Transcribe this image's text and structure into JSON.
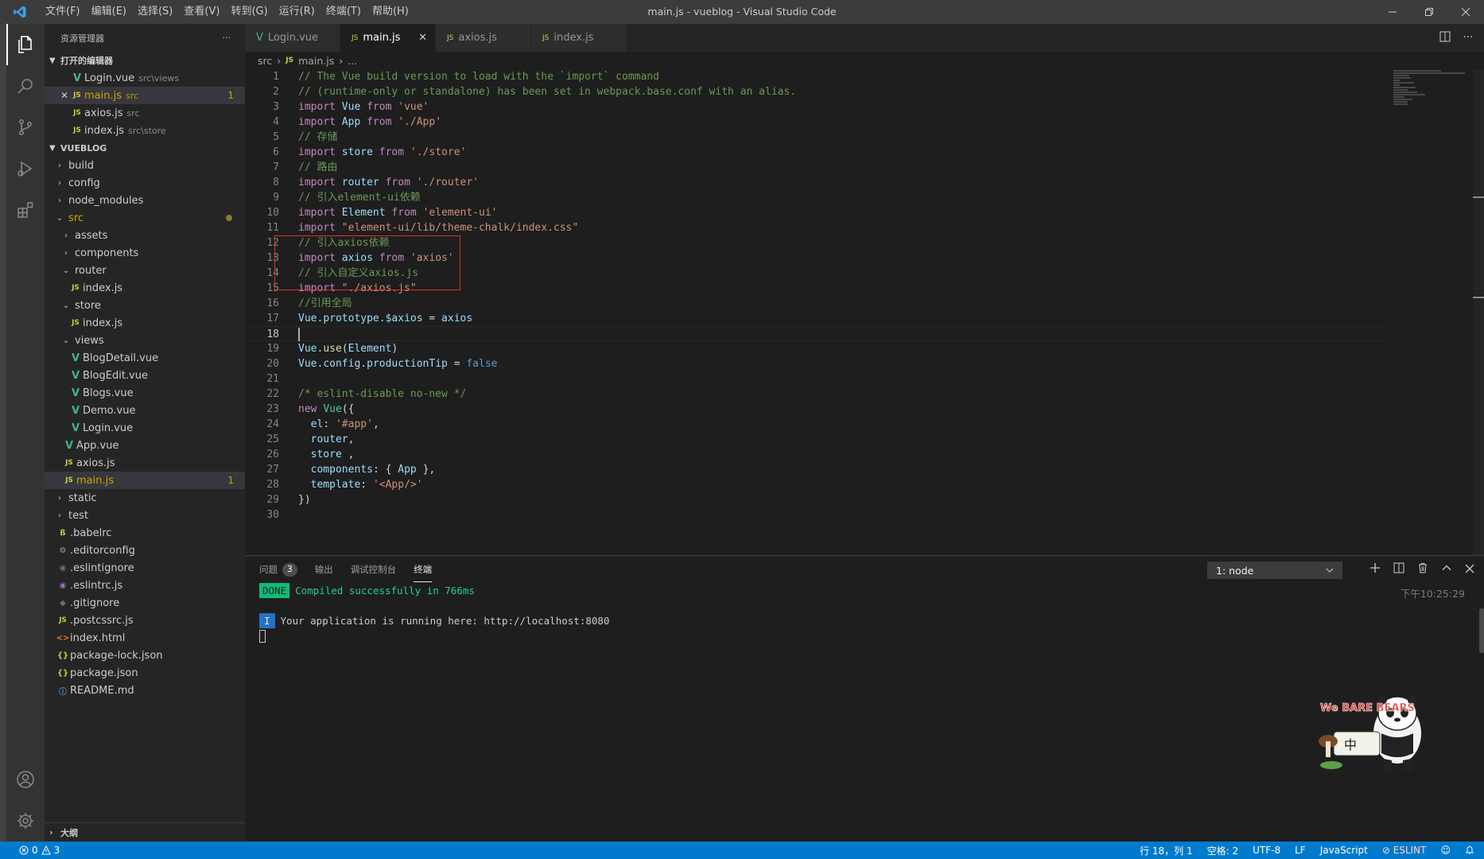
{
  "window": {
    "title": "main.js - vueblog - Visual Studio Code",
    "menu": [
      "文件(F)",
      "编辑(E)",
      "选择(S)",
      "查看(V)",
      "转到(G)",
      "运行(R)",
      "终端(T)",
      "帮助(H)"
    ]
  },
  "sidebar": {
    "header": "资源管理器",
    "more": "···",
    "open_editors": {
      "title": "打开的编辑器",
      "items": [
        {
          "icon": "V",
          "name": "Login.vue",
          "desc": "src\\views"
        },
        {
          "icon": "JS",
          "name": "main.js",
          "desc": "src",
          "badge": "1",
          "close": "✕"
        },
        {
          "icon": "JS",
          "name": "axios.js",
          "desc": "src"
        },
        {
          "icon": "JS",
          "name": "index.js",
          "desc": "src\\store"
        }
      ]
    },
    "project": {
      "title": "VUEBLOG",
      "tree": [
        {
          "name": "build"
        },
        {
          "name": "config"
        },
        {
          "name": "node_modules"
        },
        {
          "name": "src"
        },
        {
          "name": "assets"
        },
        {
          "name": "components"
        },
        {
          "name": "router"
        },
        {
          "name": "index.js"
        },
        {
          "name": "store"
        },
        {
          "name": "index.js"
        },
        {
          "name": "views"
        },
        {
          "name": "BlogDetail.vue"
        },
        {
          "name": "BlogEdit.vue"
        },
        {
          "name": "Blogs.vue"
        },
        {
          "name": "Demo.vue"
        },
        {
          "name": "Login.vue"
        },
        {
          "name": "App.vue"
        },
        {
          "name": "axios.js"
        },
        {
          "name": "main.js",
          "badge": "1"
        },
        {
          "name": "static"
        },
        {
          "name": "test"
        },
        {
          "name": ".babelrc"
        },
        {
          "name": ".editorconfig"
        },
        {
          "name": ".eslintignore"
        },
        {
          "name": ".eslintrc.js"
        },
        {
          "name": ".gitignore"
        },
        {
          "name": ".postcssrc.js"
        },
        {
          "name": "index.html"
        },
        {
          "name": "package-lock.json"
        },
        {
          "name": "package.json"
        },
        {
          "name": "README.md"
        }
      ]
    },
    "outline_title": "大纲"
  },
  "editor": {
    "tabs": [
      {
        "icon": "V",
        "label": "Login.vue"
      },
      {
        "icon": "JS",
        "label": "main.js",
        "close": "✕"
      },
      {
        "icon": "JS",
        "label": "axios.js"
      },
      {
        "icon": "JS",
        "label": "index.js"
      }
    ],
    "breadcrumb": {
      "folder": "src",
      "file_icon": "JS",
      "file": "main.js",
      "more": "..."
    },
    "current_line": 18,
    "lines": [
      "// The Vue build version to load with the `import` command",
      "// (runtime-only or standalone) has been set in webpack.base.conf with an alias.",
      "import Vue from 'vue'",
      "import App from './App'",
      "// 存储",
      "import store from './store'",
      "// 路由",
      "import router from './router'",
      "// 引入element-ui依赖",
      "import Element from 'element-ui'",
      "import \"element-ui/lib/theme-chalk/index.css\"",
      "// 引入axios依赖",
      "import axios from 'axios'",
      "// 引入自定义axios.js",
      "import \"./axios.js\"",
      "//引用全局",
      "Vue.prototype.$axios = axios",
      "",
      "Vue.use(Element)",
      "Vue.config.productionTip = false",
      "",
      "/* eslint-disable no-new */",
      "new Vue({",
      "  el: '#app',",
      "  router,",
      "  store ,",
      "  components: { App },",
      "  template: '<App/>'",
      "})",
      ""
    ]
  },
  "panel": {
    "tabs": [
      {
        "label": "问题",
        "count": "3"
      },
      {
        "label": "输出"
      },
      {
        "label": "调试控制台"
      },
      {
        "label": "终端"
      }
    ],
    "terminal_select": "1: node",
    "time": "下午10:25:29",
    "terminal": {
      "done_tag": "DONE",
      "compiled": "Compiled successfully in 766ms",
      "info_tag": "I",
      "running": "Your application is running here: http://localhost:8080"
    },
    "sticker_text": {
      "brand": "We BARE BEARS",
      "char": "中"
    }
  },
  "status": {
    "errors": "0",
    "warnings": "3",
    "position": "行 18，列 1",
    "spaces": "空格: 2",
    "encoding": "UTF-8",
    "eol": "LF",
    "language": "JavaScript",
    "eslint": "ESLINT"
  },
  "colors": {
    "accent": "#007acc",
    "editor_bg": "#1e1e1e",
    "sidebar_bg": "#252526",
    "highlight_box": "#e0302d",
    "modified": "#cca700"
  }
}
